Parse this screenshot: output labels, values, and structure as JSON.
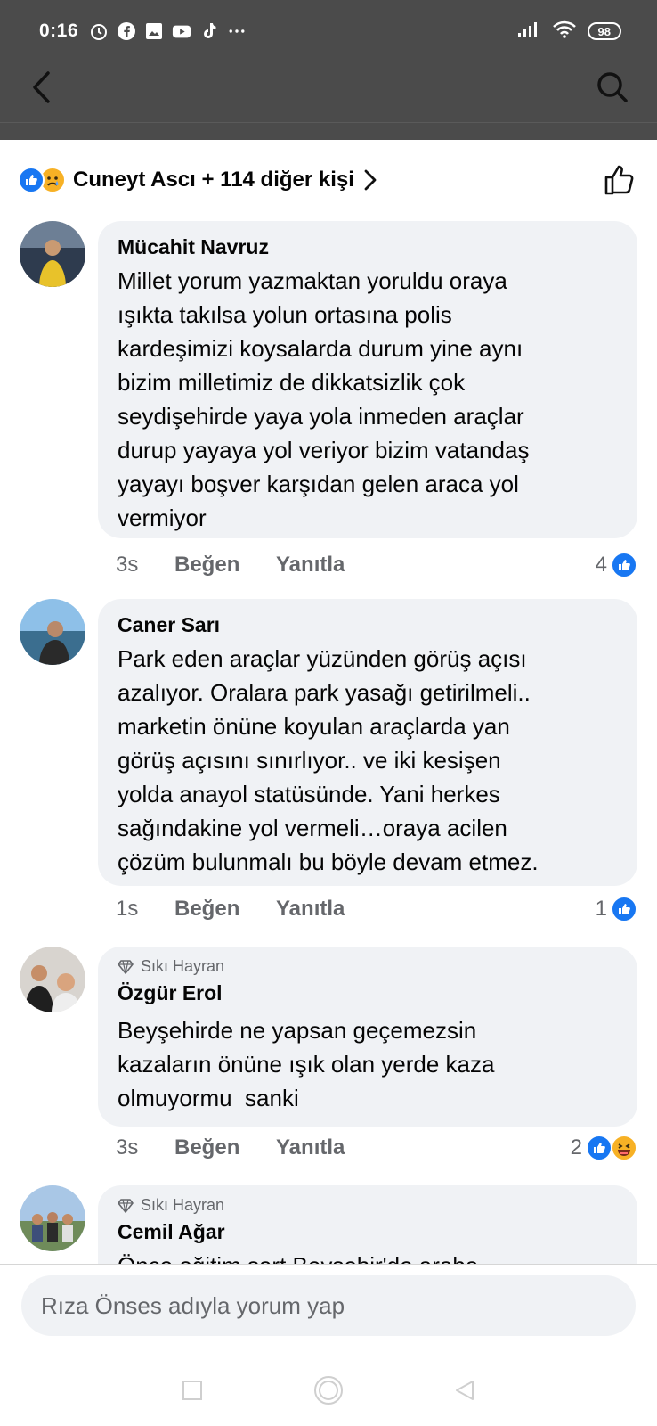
{
  "status": {
    "time": "0:16",
    "battery": "98",
    "notification_icons": [
      "alarm-icon",
      "facebook-icon",
      "gallery-icon",
      "youtube-icon",
      "tiktok-icon",
      "more-icon"
    ]
  },
  "header": {
    "back_icon": "back-chevron-icon",
    "search_icon": "search-icon"
  },
  "reactions": {
    "summary": "Cuneyt Ascı + 114 diğer kişi",
    "icons": [
      "like-reaction-icon",
      "sad-reaction-icon"
    ],
    "like_button_icon": "thumbs-up-outline-icon"
  },
  "comments": [
    {
      "badge": "",
      "author": "Mücahit Navruz",
      "text": [
        "Millet yorum yazmaktan yoruldu oraya",
        "ışıkta takılsa yolun ortasına polis",
        "kardeşimizi koysalarda durum yine aynı",
        "bizim milletimiz de dikkatsizlik çok",
        "seydişehirde yaya yola inmeden araçlar",
        "durup yayaya yol veriyor bizim vatandaş",
        "yayayı boşver karşıdan gelen araca yol",
        "vermiyor"
      ],
      "time": "3s",
      "like_label": "Beğen",
      "reply_label": "Yanıtla",
      "reaction_count": "4"
    },
    {
      "badge": "",
      "author": "Caner Sarı",
      "text": [
        "Park eden araçlar yüzünden görüş açısı",
        "azalıyor. Oralara park yasağı getirilmeli..",
        "marketin önüne koyulan araçlarda yan",
        "görüş açısını sınırlıyor.. ve iki kesişen",
        "yolda anayol statüsünde. Yani herkes",
        "sağındakine yol vermeli…oraya acilen",
        "çözüm bulunmalı bu böyle devam etmez."
      ],
      "time": "1s",
      "like_label": "Beğen",
      "reply_label": "Yanıtla",
      "reaction_count": "1"
    },
    {
      "badge": "Sıkı Hayran",
      "author": "Özgür Erol",
      "text": [
        "Beyşehirde ne yapsan geçemezsin",
        "kazaların önüne ışık olan yerde kaza",
        "olmuyormu  sanki"
      ],
      "time": "3s",
      "like_label": "Beğen",
      "reply_label": "Yanıtla",
      "reaction_count": "2"
    },
    {
      "badge": "Sıkı Hayran",
      "author": "Cemil Ağar",
      "text": [
        "Önce eğitim sart Beysehir'de araba"
      ],
      "time": "",
      "like_label": "",
      "reply_label": "",
      "reaction_count": ""
    }
  ],
  "composer": {
    "placeholder": "Rıza Önses adıyla yorum yap"
  },
  "navbar": {
    "icons": [
      "recent-apps-icon",
      "home-icon",
      "back-triangle-icon"
    ]
  },
  "colors": {
    "topbar": "#4b4b4b",
    "like_blue": "#1877f2",
    "bubble": "#f0f2f5",
    "meta_gray": "#65676b"
  }
}
